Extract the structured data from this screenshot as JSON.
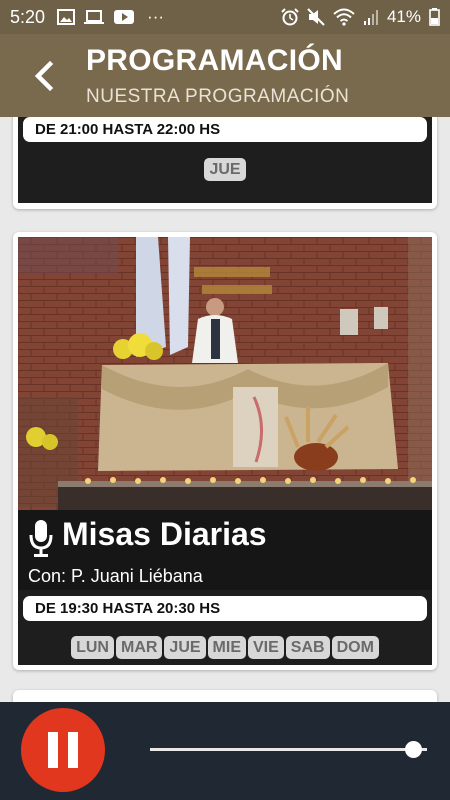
{
  "status_bar": {
    "time": "5:20",
    "more_label": "···",
    "battery": "41%",
    "icons": [
      "image-icon",
      "laptop-icon",
      "youtube-icon",
      "alarm-icon",
      "mute-icon",
      "wifi-icon",
      "signal-icon",
      "battery-icon"
    ]
  },
  "header": {
    "title": "PROGRAMACIÓN",
    "subtitle": "NUESTRA PROGRAMACIÓN",
    "back_icon": "back-arrow-icon"
  },
  "programs": [
    {
      "schedule": "DE 21:00 HASTA 22:00 HS",
      "days": [
        "JUE"
      ]
    },
    {
      "title": "Misas Diarias",
      "host": "Con: P. Juani Liébana",
      "schedule": "DE 19:30 HASTA 20:30 HS",
      "days": [
        "LUN",
        "MAR",
        "JUE",
        "MIE",
        "VIE",
        "SAB",
        "DOM"
      ],
      "icon": "microphone-icon"
    }
  ],
  "player": {
    "state": "playing",
    "progress": 0.95,
    "accent_color": "#e2371f",
    "background_color": "#202933"
  },
  "colors": {
    "status_bar": "#6f6148",
    "header": "#7a6a4d"
  }
}
